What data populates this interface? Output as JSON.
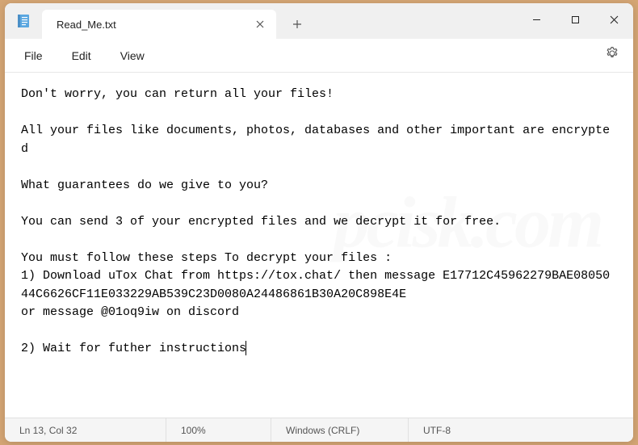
{
  "tab": {
    "title": "Read_Me.txt"
  },
  "menu": {
    "file": "File",
    "edit": "Edit",
    "view": "View"
  },
  "content": {
    "text": "Don't worry, you can return all your files!\n\nAll your files like documents, photos, databases and other important are encrypted\n\nWhat guarantees do we give to you?\n\nYou can send 3 of your encrypted files and we decrypt it for free.\n\nYou must follow these steps To decrypt your files :\n1) Download uTox Chat from https://tox.chat/ then message E17712C45962279BAE0805044C6626CF11E033229AB539C23D0080A24486861B30A20C898E4E\nor message @01oq9iw on discord\n\n2) Wait for futher instructions"
  },
  "statusbar": {
    "position": "Ln 13, Col 32",
    "zoom": "100%",
    "lineending": "Windows (CRLF)",
    "encoding": "UTF-8"
  },
  "watermark": "pcisk.com"
}
